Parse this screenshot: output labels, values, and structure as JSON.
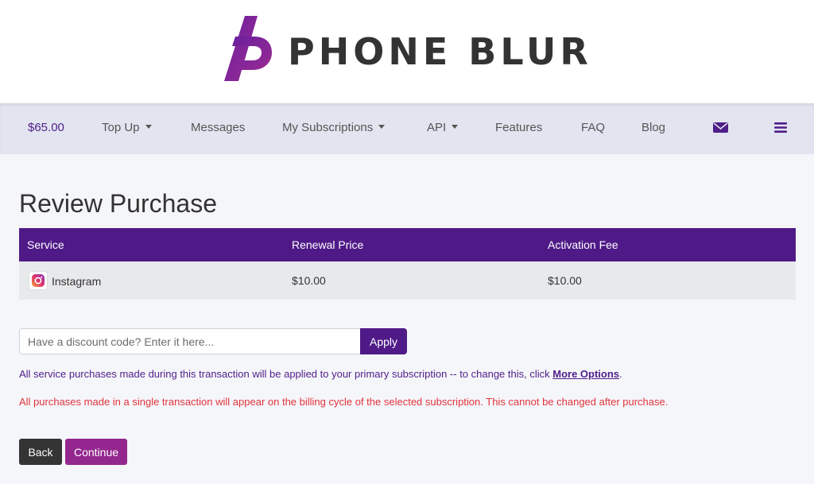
{
  "brand": {
    "name": "PHONE BLUR",
    "logo_icon": "phone-blur-logo",
    "accent": "#4f1a87",
    "accent_alt": "#94278f"
  },
  "nav": {
    "balance": "$65.00",
    "top_up": "Top Up",
    "messages": "Messages",
    "my_subscriptions": "My Subscriptions",
    "api": "API",
    "features": "Features",
    "faq": "FAQ",
    "blog": "Blog",
    "mail_icon": "envelope-icon",
    "menu_icon": "hamburger-icon"
  },
  "page": {
    "title": "Review Purchase"
  },
  "table": {
    "headers": {
      "service": "Service",
      "renewal_price": "Renewal Price",
      "activation_fee": "Activation Fee"
    },
    "rows": [
      {
        "service": "Instagram",
        "icon": "instagram-icon",
        "renewal_price": "$10.00",
        "activation_fee": "$10.00"
      }
    ]
  },
  "discount": {
    "placeholder": "Have a discount code? Enter it here...",
    "value": "",
    "apply_label": "Apply"
  },
  "notes": {
    "primary_text": "All service purchases made during this transaction will be applied to your primary subscription -- to change this, click ",
    "more_options": "More Options",
    "period": ".",
    "warning": "All purchases made in a single transaction will appear on the billing cycle of the selected subscription. This cannot be changed after purchase."
  },
  "actions": {
    "back": "Back",
    "continue": "Continue"
  }
}
